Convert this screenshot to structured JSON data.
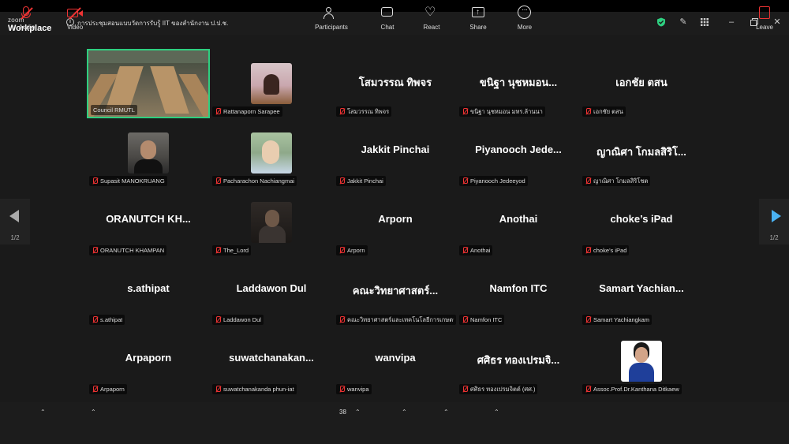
{
  "window": {
    "brand_small": "zoom",
    "brand_large": "Workplace",
    "meeting_title": "การประชุมสอนแบบวัดการรับรู้ IIT ของสำนักงาน ป.ป.ช.",
    "info_icon": "info-icon",
    "icons": [
      "shield-icon",
      "pen-icon",
      "grid-view-icon",
      "minimize-icon",
      "restore-icon",
      "close-icon"
    ]
  },
  "colors": {
    "active_border": "#2ecf80",
    "muted_red": "#e33333",
    "page_arrow": "#4ab2f2",
    "background": "#1a1a1a"
  },
  "participants": [
    {
      "label": "Council RMUTL",
      "kind": "video",
      "active": true
    },
    {
      "label": "Rattanaporn Sarapee",
      "kind": "photo",
      "avatar": "av-house"
    },
    {
      "big": "โสมวรรณ ทิพจร",
      "label": "โสมวรรณ ทิพจร",
      "kind": "name"
    },
    {
      "big": "ขนิฐา นุชหมอน...",
      "label": "ขนิฐา นุชหมอน มทร.ล้านนา",
      "kind": "name"
    },
    {
      "big": "เอกชัย ตสน",
      "label": "เอกชัย ตสน",
      "kind": "name"
    },
    {
      "label": "Supasit MANOKRUANG",
      "kind": "photo",
      "avatar": "av-man"
    },
    {
      "label": "Pacharachon Nachiangmai",
      "kind": "photo",
      "avatar": "av-girl"
    },
    {
      "big": "Jakkit Pinchai",
      "label": "Jakkit Pinchai",
      "kind": "name"
    },
    {
      "big": "Piyanooch Jede...",
      "label": "Piyanooch Jedeeyod",
      "kind": "name"
    },
    {
      "big": "ญาณิศา โกมลสิริโ...",
      "label": "ญาณิศา โกมลสิริโชต",
      "kind": "name"
    },
    {
      "big": "ORANUTCH KH...",
      "label": "ORANUTCH KHAMPAN",
      "kind": "name"
    },
    {
      "label": "The_Lord",
      "kind": "photo",
      "avatar": "av-dark"
    },
    {
      "big": "Arporn",
      "label": "Arporn",
      "kind": "name"
    },
    {
      "big": "Anothai",
      "label": "Anothai",
      "kind": "name"
    },
    {
      "big": "choke’s iPad",
      "label": "choke’s iPad",
      "kind": "name"
    },
    {
      "big": "s.athipat",
      "label": "s.athipat",
      "kind": "name"
    },
    {
      "big": "Laddawon Dul",
      "label": "Laddawon Dul",
      "kind": "name"
    },
    {
      "big": "คณะวิทยาศาสตร์...",
      "label": "คณะวิทยาศาสตร์และเทคโนโลยีการเกษตร ว...",
      "kind": "name"
    },
    {
      "big": "Namfon ITC",
      "label": "Namfon ITC",
      "kind": "name"
    },
    {
      "big": "Samart Yachian...",
      "label": "Samart Yachiangkam",
      "kind": "name"
    },
    {
      "big": "Arpaporn",
      "label": "Arpaporn",
      "kind": "name"
    },
    {
      "big": "suwatchanakan...",
      "label": "suwatchanakanda phun-iat",
      "kind": "name"
    },
    {
      "big": "wanvipa",
      "label": "wanvipa",
      "kind": "name"
    },
    {
      "big": "ศศิธร ทองเปรมจิ...",
      "label": "ศศิธร ทองเปรมจิตต์ (ศศ.)",
      "kind": "name"
    },
    {
      "label": "Assoc.Prof.Dr.Kanthana Ditkaew",
      "kind": "photo",
      "avatar": "av-lady"
    }
  ],
  "pager": {
    "left": "1/2",
    "right": "1/2"
  },
  "toolbar": {
    "audio": "Audio",
    "video": "Video",
    "participants": "Participants",
    "participant_count": "38",
    "chat": "Chat",
    "react": "React",
    "share": "Share",
    "more": "More",
    "leave": "Leave"
  }
}
